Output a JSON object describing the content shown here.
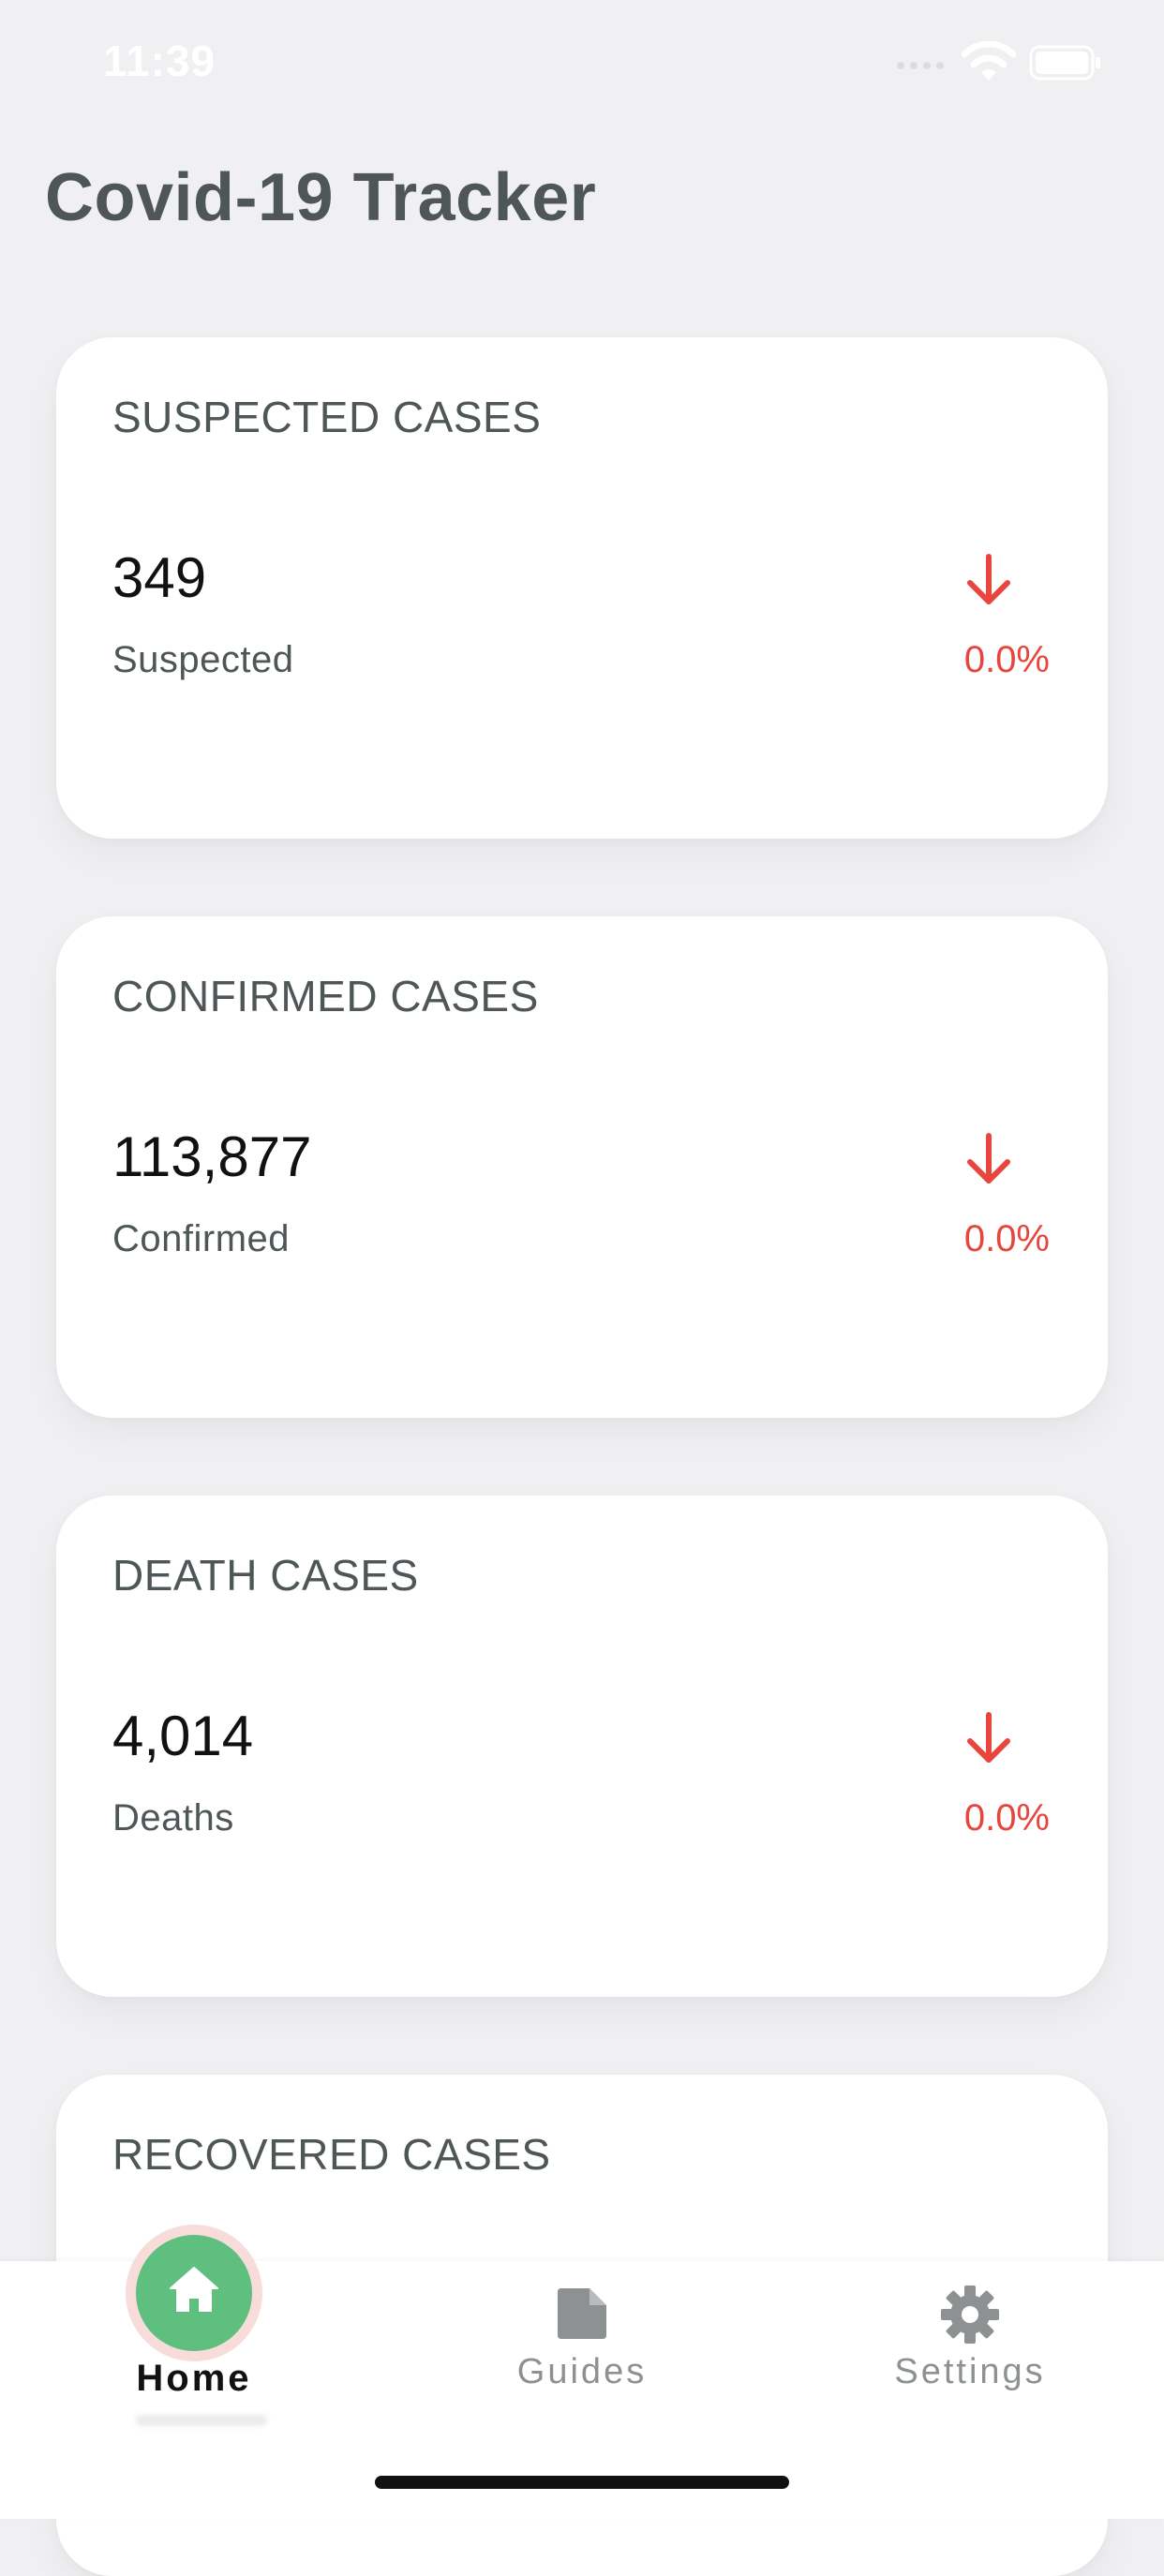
{
  "status_bar": {
    "time": "11:39"
  },
  "header": {
    "title": "Covid-19 Tracker"
  },
  "cards": [
    {
      "title": "SUSPECTED CASES",
      "value": "349",
      "label": "Suspected",
      "trend_icon": "arrow-down-icon",
      "change": "0.0%"
    },
    {
      "title": "CONFIRMED CASES",
      "value": "113,877",
      "label": "Confirmed",
      "trend_icon": "arrow-down-icon",
      "change": "0.0%"
    },
    {
      "title": "DEATH CASES",
      "value": "4,014",
      "label": "Deaths",
      "trend_icon": "arrow-down-icon",
      "change": "0.0%"
    },
    {
      "title": "RECOVERED CASES"
    }
  ],
  "tab_bar": {
    "home": {
      "label": "Home",
      "icon": "home-icon",
      "selected": true
    },
    "guides": {
      "label": "Guides",
      "icon": "document-icon"
    },
    "settings": {
      "label": "Settings",
      "icon": "gear-icon"
    }
  },
  "colors": {
    "background": "#f0f0f2",
    "title_text": "#4f5657",
    "trend_red": "#e8453c",
    "home_green": "#5ebf7f",
    "tab_inactive": "#8d9191"
  }
}
